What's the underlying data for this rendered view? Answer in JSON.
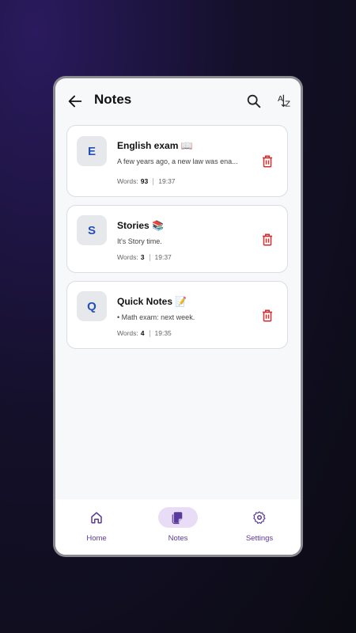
{
  "header": {
    "title": "Notes",
    "back_icon": "arrow-left-icon",
    "search_icon": "search-icon",
    "sort_icon": "sort-az-icon"
  },
  "notes": [
    {
      "initial": "E",
      "title": "English exam 📖",
      "preview": "A few years ago, a new law was ena...",
      "words_label": "Words:",
      "words": "93",
      "time": "19:37"
    },
    {
      "initial": "S",
      "title": "Stories 📚",
      "preview": "It's Story time.",
      "words_label": "Words:",
      "words": "3",
      "time": "19:37"
    },
    {
      "initial": "Q",
      "title": "Quick Notes 📝",
      "preview": "• Math exam: next week.",
      "words_label": "Words:",
      "words": "4",
      "time": "19:35"
    }
  ],
  "bottom_nav": {
    "items": [
      {
        "label": "Home",
        "icon": "home-icon",
        "active": false
      },
      {
        "label": "Notes",
        "icon": "notes-icon",
        "active": true
      },
      {
        "label": "Settings",
        "icon": "settings-icon",
        "active": false
      }
    ]
  },
  "colors": {
    "accent": "#5a3a9a",
    "avatar_text": "#2450b4",
    "delete": "#d32f2f",
    "active_pill": "#e9dcf7"
  }
}
